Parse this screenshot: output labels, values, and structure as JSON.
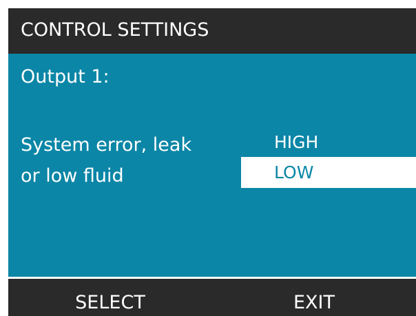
{
  "header": {
    "title": "CONTROL SETTINGS"
  },
  "main": {
    "output_label": "Output 1:",
    "setting": {
      "name_line1": "System error, leak",
      "name_line2": "or low fluid",
      "options": [
        "HIGH",
        "LOW"
      ],
      "selected": "LOW"
    }
  },
  "footer": {
    "left_softkey": "SELECT",
    "right_softkey": "EXIT"
  },
  "colors": {
    "background_panel": "#0b86a6",
    "header_footer": "#2a2a2a",
    "highlight": "#ffffff",
    "text": "#ffffff"
  }
}
